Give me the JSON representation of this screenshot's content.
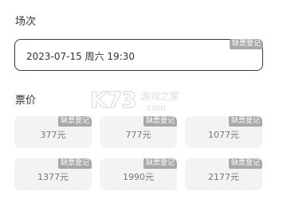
{
  "session": {
    "title": "场次",
    "selected_value": "2023-07-15 周六 19:30",
    "tag": "缺票登记"
  },
  "price": {
    "title": "票价",
    "tag": "缺票登记",
    "options": [
      {
        "label": "377元"
      },
      {
        "label": "777元"
      },
      {
        "label": "1077元"
      },
      {
        "label": "1377元"
      },
      {
        "label": "1990元"
      },
      {
        "label": "2177元"
      }
    ]
  },
  "watermark": {
    "brand": "K73",
    "text": "游戏之家",
    "domain": ".com"
  }
}
